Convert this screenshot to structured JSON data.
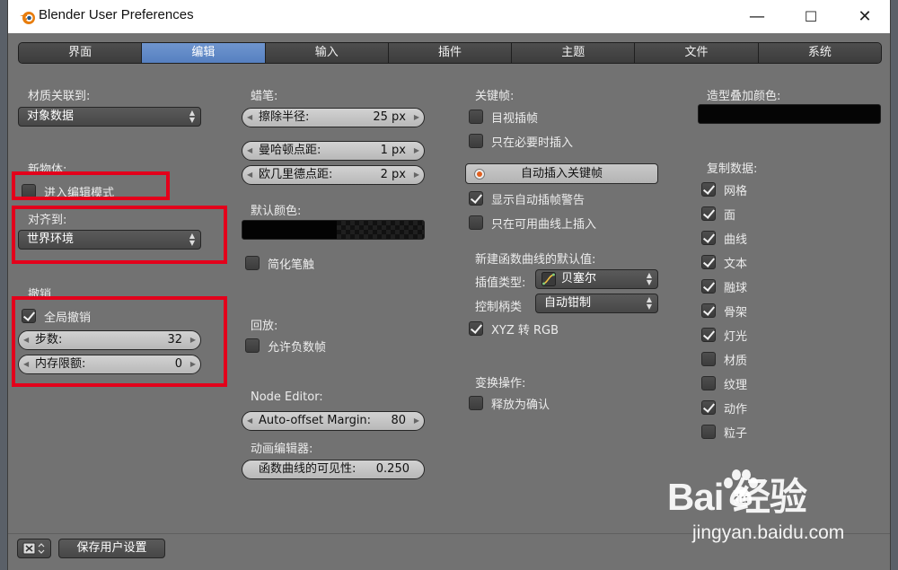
{
  "window": {
    "title": "Blender User Preferences"
  },
  "titlebar_buttons": {
    "minimize": "—",
    "maximize": "☐",
    "close": "✕"
  },
  "tabs": [
    {
      "label": "界面",
      "active": false
    },
    {
      "label": "编辑",
      "active": true
    },
    {
      "label": "输入",
      "active": false
    },
    {
      "label": "插件",
      "active": false
    },
    {
      "label": "主题",
      "active": false
    },
    {
      "label": "文件",
      "active": false
    },
    {
      "label": "系统",
      "active": false
    }
  ],
  "col1": {
    "link_materials_label": "材质关联到:",
    "link_materials_value": "对象数据",
    "new_objects_label": "新物体:",
    "enter_edit_mode": {
      "label": "进入编辑模式",
      "checked": false
    },
    "align_to_label": "对齐到:",
    "align_to_value": "世界环境",
    "undo_label": "撤销",
    "global_undo": {
      "label": "全局撤销",
      "checked": true
    },
    "steps": {
      "label": "步数:",
      "value": "32"
    },
    "memory_limit": {
      "label": "内存限额:",
      "value": "0"
    }
  },
  "col2": {
    "grease_label": "蜡笔:",
    "eraser_radius": {
      "label": "擦除半径:",
      "value": "25 px"
    },
    "manhattan": {
      "label": "曼哈顿点距:",
      "value": "1 px"
    },
    "euclidean": {
      "label": "欧几里德点距:",
      "value": "2 px"
    },
    "default_color_label": "默认颜色:",
    "simplify_stroke": {
      "label": "简化笔触",
      "checked": false
    },
    "playback_label": "回放:",
    "allow_negative": {
      "label": "允许负数帧",
      "checked": false
    },
    "node_editor_label": "Node Editor:",
    "auto_offset": {
      "label": "Auto-offset Margin:",
      "value": "80"
    },
    "anim_editors_label": "动画编辑器:",
    "fcurve_vis": {
      "label": "函数曲线的可见性:",
      "value": "0.250"
    }
  },
  "col3": {
    "keyframing_label": "关键帧:",
    "visual_keying": {
      "label": "目视插帧",
      "checked": false
    },
    "only_needed": {
      "label": "只在必要时插入",
      "checked": false
    },
    "auto_keying": "自动插入关键帧",
    "show_auto_warning": {
      "label": "显示自动插帧警告",
      "checked": true
    },
    "only_available": {
      "label": "只在可用曲线上插入",
      "checked": false
    },
    "new_fcurve_label": "新建函数曲线的默认值:",
    "interp_label": "插值类型:",
    "interp_value": "贝塞尔",
    "handle_label": "控制柄类",
    "handle_value": "自动钳制",
    "xyz_rgb": {
      "label": "XYZ 转 RGB",
      "checked": true
    },
    "transform_label": "变换操作:",
    "release_confirm": {
      "label": "释放为确认",
      "checked": false
    }
  },
  "col4": {
    "sculpt_overlay_label": "造型叠加颜色:",
    "duplicate_label": "复制数据:",
    "dup_items": [
      {
        "label": "网格",
        "checked": true
      },
      {
        "label": "面",
        "checked": true
      },
      {
        "label": "曲线",
        "checked": true
      },
      {
        "label": "文本",
        "checked": true
      },
      {
        "label": "融球",
        "checked": true
      },
      {
        "label": "骨架",
        "checked": true
      },
      {
        "label": "灯光",
        "checked": true
      },
      {
        "label": "材质",
        "checked": false
      },
      {
        "label": "纹理",
        "checked": false
      },
      {
        "label": "动作",
        "checked": true
      },
      {
        "label": "粒子",
        "checked": false
      }
    ]
  },
  "bottom": {
    "save_label": "保存用户设置"
  },
  "watermark": {
    "main": "Bai 经验",
    "sub": "jingyan.baidu.com"
  },
  "colors": {
    "active_tab": "#5680c0",
    "highlight_box": "#e3001b",
    "panel_bg": "#727272"
  }
}
